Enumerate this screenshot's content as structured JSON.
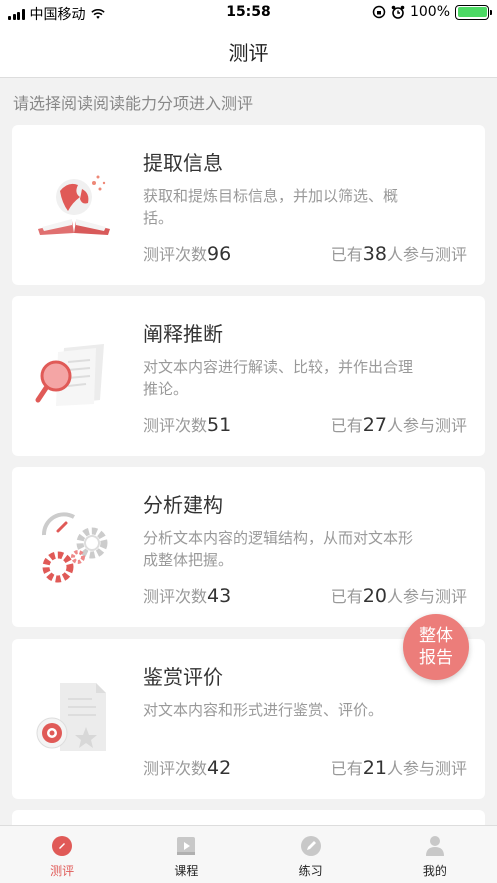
{
  "status_bar": {
    "carrier": "中国移动",
    "time": "15:58",
    "battery": "100%"
  },
  "nav": {
    "title": "测评"
  },
  "hint": "请选择阅读阅读能力分项进入测评",
  "cards": [
    {
      "title": "提取信息",
      "desc": "获取和提炼目标信息，并加以筛选、概括。",
      "count_label": "测评次数",
      "count": "96",
      "part_prefix": "已有",
      "part_num": "38",
      "part_suffix": "人参与测评",
      "icon": "globe-book-icon"
    },
    {
      "title": "阐释推断",
      "desc": "对文本内容进行解读、比较，并作出合理推论。",
      "count_label": "测评次数",
      "count": "51",
      "part_prefix": "已有",
      "part_num": "27",
      "part_suffix": "人参与测评",
      "icon": "magnifier-document-icon"
    },
    {
      "title": "分析建构",
      "desc": "分析文本内容的逻辑结构，从而对文本形成整体把握。",
      "count_label": "测评次数",
      "count": "43",
      "part_prefix": "已有",
      "part_num": "20",
      "part_suffix": "人参与测评",
      "icon": "gears-icon"
    },
    {
      "title": "鉴赏评价",
      "desc": "对文本内容和形式进行鉴赏、评价。",
      "count_label": "测评次数",
      "count": "42",
      "part_prefix": "已有",
      "part_num": "21",
      "part_suffix": "人参与测评",
      "icon": "eye-document-icon"
    }
  ],
  "fab": {
    "line1": "整体",
    "line2": "报告"
  },
  "tabs": [
    {
      "label": "测评",
      "icon": "assessment-icon",
      "active": true
    },
    {
      "label": "课程",
      "icon": "course-icon",
      "active": false
    },
    {
      "label": "练习",
      "icon": "practice-icon",
      "active": false
    },
    {
      "label": "我的",
      "icon": "profile-icon",
      "active": false
    }
  ],
  "colors": {
    "accent": "#e05a57",
    "fab": "#ec7d7a",
    "battery": "#4cd964"
  }
}
